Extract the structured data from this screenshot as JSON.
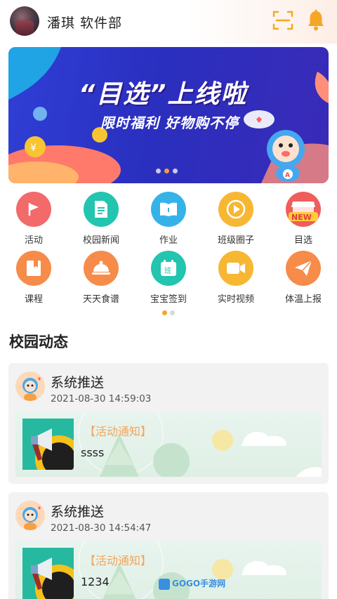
{
  "header": {
    "user_name": "潘琪 软件部",
    "icons": {
      "scan": "scan-icon",
      "bell": "bell-icon"
    },
    "accent_color": "#f5a623"
  },
  "banner": {
    "title": "“目选”上线啦",
    "subtitle": "限时福利 好物购不停",
    "dots_total": 3,
    "dots_active_index": 1
  },
  "features": {
    "row1": [
      {
        "label": "活动",
        "icon": "flag-icon",
        "color": "#f26a6a"
      },
      {
        "label": "校园新闻",
        "icon": "document-icon",
        "color": "#23c4b0"
      },
      {
        "label": "作业",
        "icon": "book-icon",
        "color": "#35b3e8"
      },
      {
        "label": "班级圈子",
        "icon": "play-icon",
        "color": "#f7b733"
      },
      {
        "label": "目选",
        "icon": "shop-new-icon",
        "color": "#f05d5d"
      }
    ],
    "row2": [
      {
        "label": "课程",
        "icon": "bookmark-icon",
        "color": "#f78b4a"
      },
      {
        "label": "天天食谱",
        "icon": "cloche-icon",
        "color": "#f78b4a"
      },
      {
        "label": "宝宝签到",
        "icon": "calendar-icon",
        "color": "#23c4b0"
      },
      {
        "label": "实时视频",
        "icon": "video-icon",
        "color": "#f7b733"
      },
      {
        "label": "体温上报",
        "icon": "paper-plane-icon",
        "color": "#f78b4a"
      }
    ],
    "pages_total": 2,
    "page_active_index": 0
  },
  "feed": {
    "title": "校园动态",
    "items": [
      {
        "sender": "系统推送",
        "time": "2021-08-30 14:59:03",
        "tag": "【活动通知】",
        "text": "ssss"
      },
      {
        "sender": "系统推送",
        "time": "2021-08-30 14:54:47",
        "tag": "【活动通知】",
        "text": "1234"
      }
    ]
  },
  "watermark": {
    "text": "GOGO手游网"
  }
}
